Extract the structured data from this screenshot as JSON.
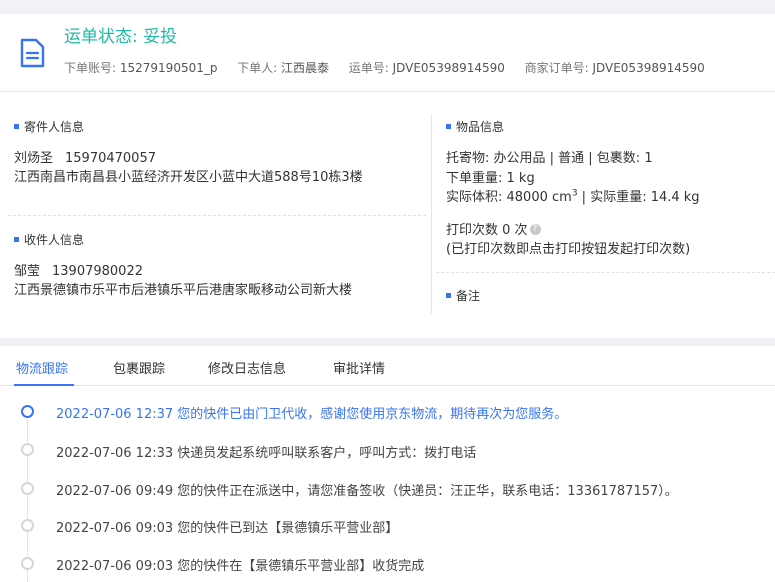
{
  "header": {
    "status_title": "运单状态: 妥投",
    "order_label": "下单账号:",
    "order_value": "15279190501_p",
    "orderer_label": "下单人:",
    "orderer_value": "江西晨泰",
    "waybill_label": "运单号:",
    "waybill_value": "JDVE05398914590",
    "merchant_label": "商家订单号:",
    "merchant_value": "JDVE05398914590"
  },
  "sender": {
    "heading": "寄件人信息",
    "name": "刘炀圣",
    "phone": "15970470057",
    "address": "江西南昌市南昌县小蓝经济开发区小蓝中大道588号10栋3楼"
  },
  "receiver": {
    "heading": "收件人信息",
    "name": "邹莹",
    "phone": "13907980022",
    "address": "江西景德镇市乐平市后港镇乐平后港唐家畈移动公司新大楼"
  },
  "goods": {
    "heading": "物品信息",
    "line1": "托寄物:  办公用品 | 普通  |  包裹数:  1",
    "line2": "下单重量:  1 kg",
    "volume_label": "实际体积:  48000 cm",
    "volume_sup": "3",
    "volume_rest": " |  实际重量:  14.4 kg",
    "print_label": "打印次数    0 次",
    "print_note": "(已打印次数即点击打印按钮发起打印次数)",
    "remark_heading": "备注"
  },
  "tabs": [
    "物流跟踪",
    "包裹跟踪",
    "修改日志信息",
    "审批详情"
  ],
  "timeline": [
    "2022-07-06 12:37 您的快件已由门卫代收，感谢您使用京东物流，期待再次为您服务。",
    "2022-07-06 12:33 快递员发起系统呼叫联系客户，呼叫方式：拨打电话",
    "2022-07-06 09:49 您的快件正在派送中，请您准备签收（快递员：汪正华，联系电话：13361787157）。",
    "2022-07-06 09:03 您的快件已到达【景德镇乐平营业部】",
    "2022-07-06 09:03 您的快件在【景德镇乐平营业部】收货完成"
  ],
  "colors": {
    "accent": "#3874f2",
    "status": "#22b8a6"
  }
}
